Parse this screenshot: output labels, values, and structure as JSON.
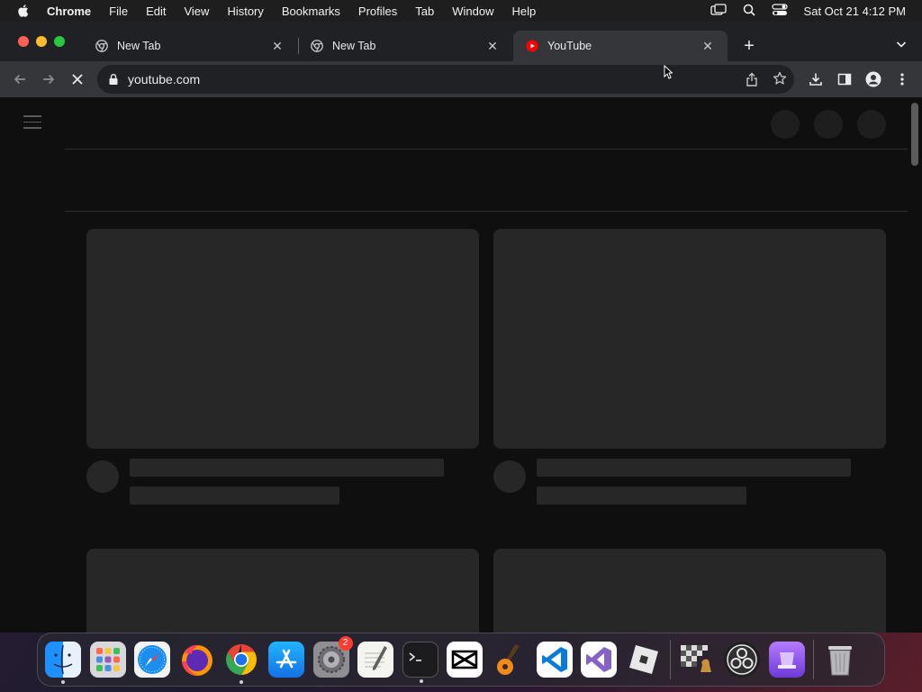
{
  "menubar": {
    "app_name": "Chrome",
    "items": [
      "File",
      "Edit",
      "View",
      "History",
      "Bookmarks",
      "Profiles",
      "Tab",
      "Window",
      "Help"
    ],
    "clock": "Sat Oct 21  4:12 PM"
  },
  "tabs": [
    {
      "title": "New Tab",
      "icon": "chrome-icon",
      "active": false
    },
    {
      "title": "New Tab",
      "icon": "chrome-icon",
      "active": false
    },
    {
      "title": "YouTube",
      "icon": "youtube-icon",
      "active": true
    }
  ],
  "toolbar": {
    "url": "youtube.com"
  },
  "dock": {
    "apps": [
      {
        "name": "Finder",
        "icon": "finder-icon",
        "running": true
      },
      {
        "name": "Launchpad",
        "icon": "launchpad-icon",
        "running": false
      },
      {
        "name": "Safari",
        "icon": "safari-icon",
        "running": false
      },
      {
        "name": "Firefox",
        "icon": "firefox-icon",
        "running": false
      },
      {
        "name": "Chrome",
        "icon": "chrome-icon",
        "running": true
      },
      {
        "name": "App Store",
        "icon": "app-store-icon",
        "running": false
      },
      {
        "name": "System Settings",
        "icon": "settings-icon",
        "running": false,
        "badge": "2"
      },
      {
        "name": "TextEdit",
        "icon": "textedit-icon",
        "running": false
      },
      {
        "name": "Terminal",
        "icon": "terminal-icon",
        "running": true
      },
      {
        "name": "CapCut",
        "icon": "capcut-icon",
        "running": false
      },
      {
        "name": "GarageBand",
        "icon": "garageband-icon",
        "running": false
      },
      {
        "name": "VS Code",
        "icon": "vscode-icon",
        "running": false
      },
      {
        "name": "Visual Studio",
        "icon": "visual-studio-icon",
        "running": false
      },
      {
        "name": "Roblox",
        "icon": "roblox-icon",
        "running": false
      }
    ],
    "recent_apps": [
      {
        "name": "Chess",
        "icon": "chess-icon"
      },
      {
        "name": "OBS",
        "icon": "obs-icon"
      },
      {
        "name": "Notchmeister",
        "icon": "purple-app-icon"
      }
    ],
    "trash": {
      "name": "Trash",
      "icon": "trash-icon"
    }
  },
  "colors": {
    "menubar_bg": "#1e1e1e",
    "tabstrip_bg": "#202124",
    "toolbar_bg": "#35363a",
    "page_bg": "#0f0f0f",
    "skeleton": "#272727"
  }
}
